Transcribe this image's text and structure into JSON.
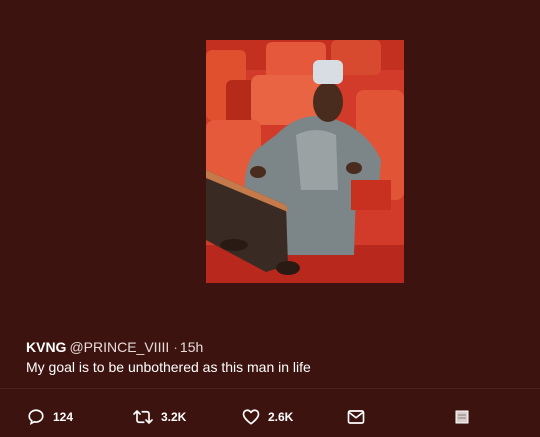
{
  "tweet": {
    "display_name": "KVNG",
    "handle": "@PRINCE_VIIII",
    "separator": "·",
    "time": "15h",
    "text": "My goal is to be unbothered as this man in life"
  },
  "actions": {
    "reply_count": "124",
    "retweet_count": "3.2K",
    "like_count": "2.6K"
  },
  "icons": {
    "reply": "reply-icon",
    "retweet": "retweet-icon",
    "like": "heart-icon",
    "dm": "envelope-icon",
    "more": "more-icon"
  },
  "colors": {
    "background": "#3d130f",
    "text": "#ffffff",
    "muted": "#e8dcda"
  }
}
